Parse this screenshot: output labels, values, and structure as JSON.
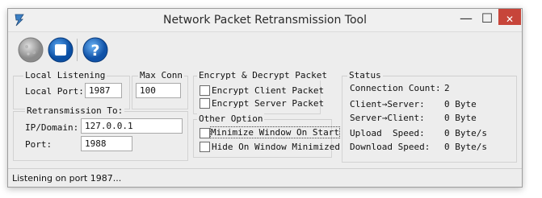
{
  "window": {
    "title": "Network Packet Retransmission Tool",
    "minimize": "—",
    "maximize": "☐",
    "close": "✕"
  },
  "toolbar": {
    "start_icon": "start-icon",
    "stop_icon": "stop-icon",
    "help_icon": "help-icon",
    "help_glyph": "?"
  },
  "local_listening": {
    "legend": "Local Listening",
    "port_label": "Local Port:",
    "port_value": "1987"
  },
  "max_conn": {
    "legend": "Max Conn",
    "value": "100"
  },
  "retransmission": {
    "legend": "Retransmission To:",
    "ip_label": "IP/Domain:",
    "ip_value": "127.0.0.1",
    "port_label": "Port:",
    "port_value": "1988"
  },
  "encrypt": {
    "legend": "Encrypt & Decrypt Packet",
    "client_label": "Encrypt Client Packet",
    "server_label": "Encrypt Server Packet"
  },
  "other": {
    "legend": "Other Option",
    "minimize_label": "Minimize Window On Start",
    "hide_label": "Hide On Window Minimized"
  },
  "status": {
    "legend": "Status",
    "rows": [
      {
        "label": "Connection Count:",
        "value": "2"
      },
      {
        "label": "Client→Server:",
        "value": "0 Byte"
      },
      {
        "label": "Server→Client:",
        "value": "0 Byte"
      },
      {
        "label": "Upload  Speed:",
        "value": "0 Byte/s"
      },
      {
        "label": "Download Speed:",
        "value": "0 Byte/s"
      }
    ]
  },
  "statusbar": {
    "text": "Listening on port 1987..."
  }
}
